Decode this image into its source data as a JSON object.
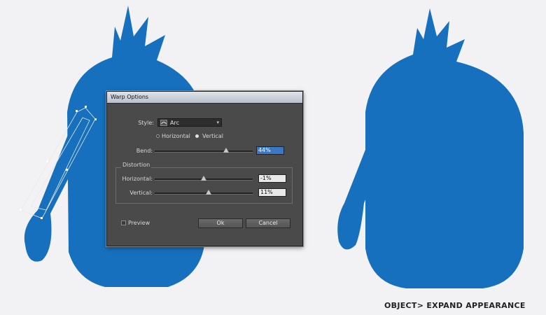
{
  "dialog": {
    "title": "Warp Options",
    "style_label": "Style:",
    "style_value": "Arc",
    "orientation": {
      "horizontal_label": "Horizontal",
      "vertical_label": "Vertical",
      "selected": "Vertical"
    },
    "bend": {
      "label": "Bend:",
      "value": "44%",
      "level_percent": 44
    },
    "distortion": {
      "group_label": "Distortion",
      "horizontal": {
        "label": "Horizontal:",
        "value": "-1%",
        "level_percent": -1
      },
      "vertical": {
        "label": "Vertical:",
        "value": "11%",
        "level_percent": 11
      }
    },
    "preview_label": "Preview",
    "ok_label": "Ok",
    "cancel_label": "Cancel"
  },
  "caption": "OBJECT> EXPAND APPEARANCE",
  "colors": {
    "monster_blue": "#1670bd",
    "dialog_bg": "#4a4a4a",
    "selection_blue": "#3a78c3"
  }
}
